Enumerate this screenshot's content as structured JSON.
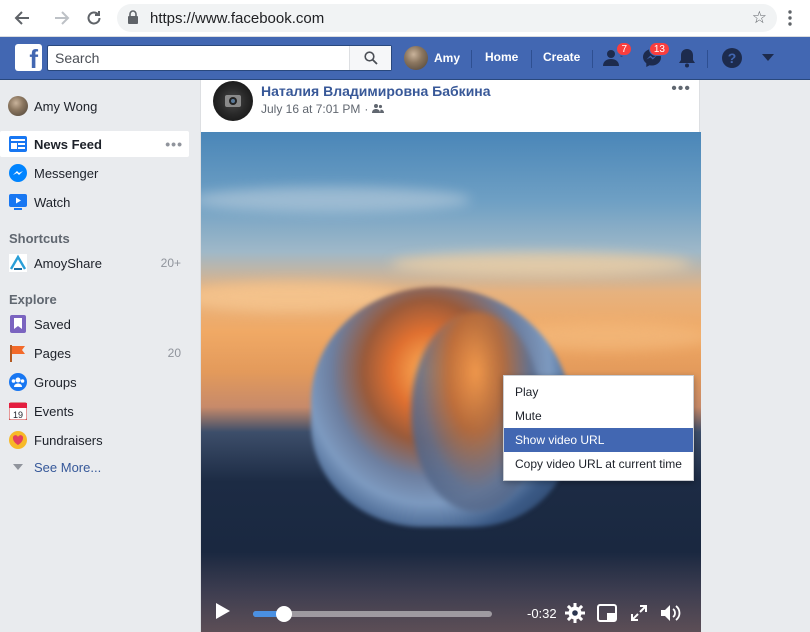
{
  "browser": {
    "url": "https://www.facebook.com"
  },
  "fbbar": {
    "search_placeholder": "Search",
    "user_name": "Amy",
    "home_label": "Home",
    "create_label": "Create",
    "friend_requests_badge": "7",
    "messages_badge": "13"
  },
  "sidebar": {
    "profile_name": "Amy Wong",
    "main_items": [
      {
        "label": "News Feed"
      },
      {
        "label": "Messenger"
      },
      {
        "label": "Watch"
      }
    ],
    "shortcuts_header": "Shortcuts",
    "shortcuts": [
      {
        "label": "AmoyShare",
        "count": "20+"
      }
    ],
    "explore_header": "Explore",
    "explore": [
      {
        "label": "Saved",
        "count": ""
      },
      {
        "label": "Pages",
        "count": "20"
      },
      {
        "label": "Groups",
        "count": ""
      },
      {
        "label": "Events",
        "count": ""
      },
      {
        "label": "Fundraisers",
        "count": ""
      }
    ],
    "see_more": "See More...",
    "events_day": "19"
  },
  "post": {
    "author": "Наталия Владимировна Бабкина",
    "date": "July 16 at 7:01 PM",
    "separator": "·"
  },
  "video": {
    "time_remaining": "-0:32",
    "progress": 0.13
  },
  "context_menu": {
    "items": [
      {
        "label": "Play"
      },
      {
        "label": "Mute"
      },
      {
        "label": "Show video URL"
      },
      {
        "label": "Copy video URL at current time"
      }
    ],
    "highlighted_index": 2
  },
  "colors": {
    "facebook_blue": "#4267b2",
    "link_blue": "#385898",
    "badge_red": "#fa3e3e",
    "progress_blue": "#4a90e2"
  }
}
